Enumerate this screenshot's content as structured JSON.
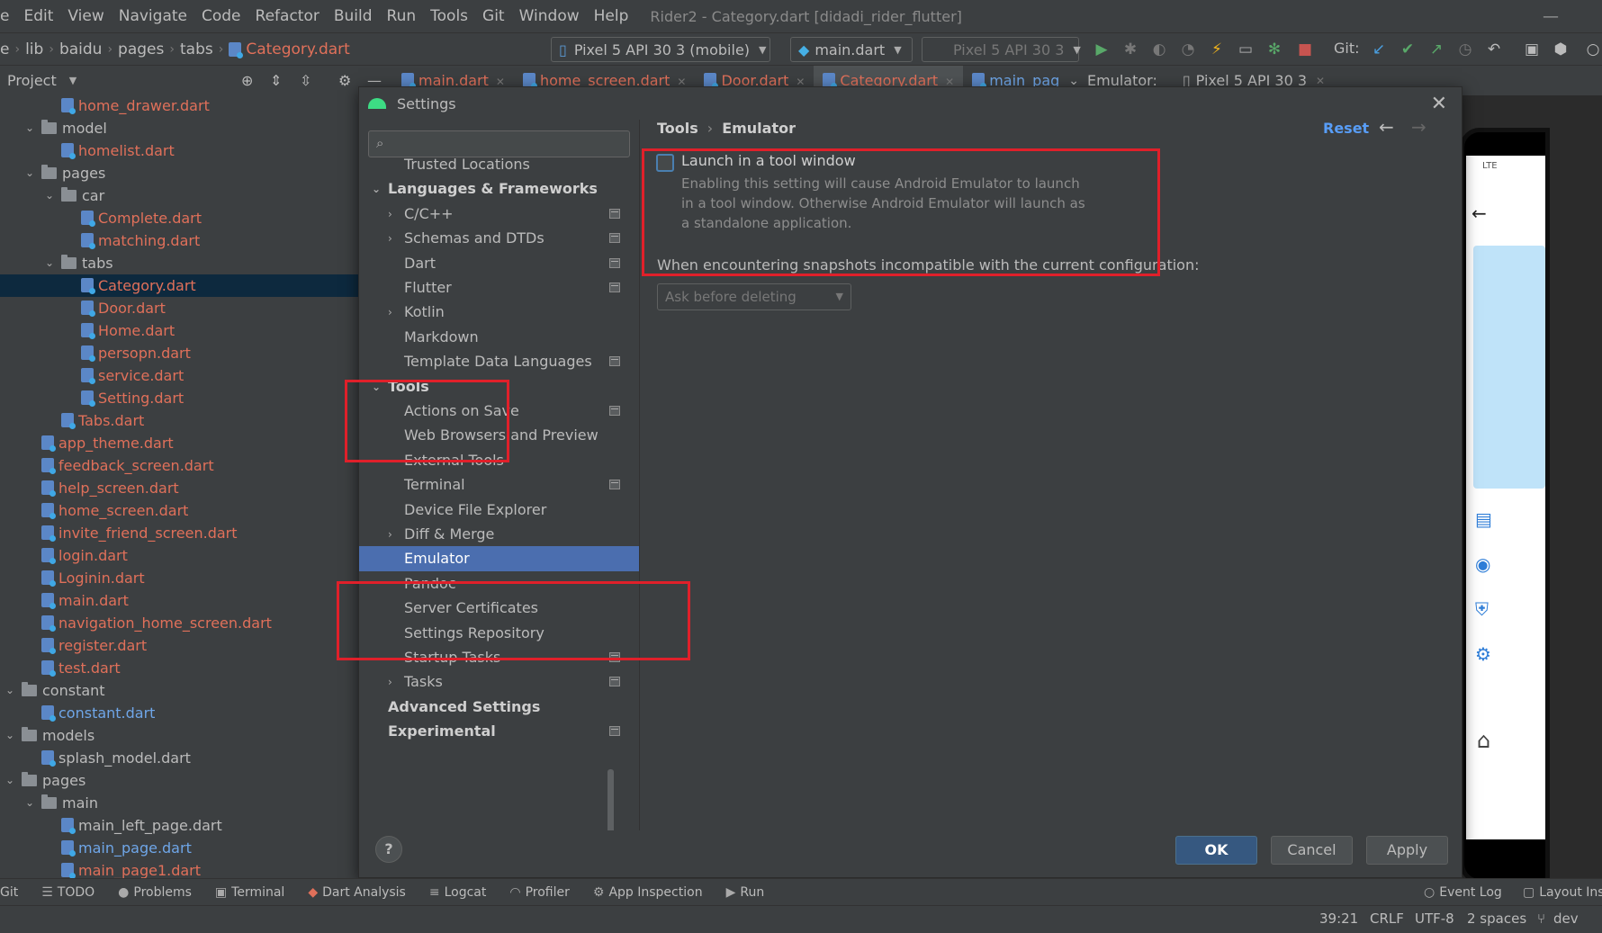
{
  "menubar": {
    "items": [
      "e",
      "Edit",
      "View",
      "Navigate",
      "Code",
      "Refactor",
      "Build",
      "Run",
      "Tools",
      "Git",
      "Window",
      "Help"
    ],
    "title": "Rider2 - Category.dart [didadi_rider_flutter]"
  },
  "navbar": {
    "crumbs": [
      "e",
      "lib",
      "baidu",
      "pages",
      "tabs",
      "Category.dart"
    ],
    "device_combo": "Pixel 5 API 30 3 (mobile)",
    "run_combo": "main.dart",
    "emulator_combo": "Pixel 5 API 30 3",
    "git_label": "Git:"
  },
  "project": {
    "header": "Project",
    "rows": [
      {
        "label": "home_drawer.dart",
        "type": "file",
        "color": "red",
        "indent": 2
      },
      {
        "label": "model",
        "type": "folder",
        "color": "gray",
        "indent": 1,
        "expanded": true
      },
      {
        "label": "homelist.dart",
        "type": "file",
        "color": "red",
        "indent": 2
      },
      {
        "label": "pages",
        "type": "folder",
        "color": "gray",
        "indent": 1,
        "expanded": true
      },
      {
        "label": "car",
        "type": "folder",
        "color": "gray",
        "indent": 2,
        "expanded": true
      },
      {
        "label": "Complete.dart",
        "type": "file",
        "color": "red",
        "indent": 3
      },
      {
        "label": "matching.dart",
        "type": "file",
        "color": "red",
        "indent": 3
      },
      {
        "label": "tabs",
        "type": "folder",
        "color": "gray",
        "indent": 2,
        "expanded": true
      },
      {
        "label": "Category.dart",
        "type": "file",
        "color": "red",
        "indent": 3,
        "selected": true
      },
      {
        "label": "Door.dart",
        "type": "file",
        "color": "red",
        "indent": 3
      },
      {
        "label": "Home.dart",
        "type": "file",
        "color": "red",
        "indent": 3
      },
      {
        "label": "persopn.dart",
        "type": "file",
        "color": "red",
        "indent": 3
      },
      {
        "label": "service.dart",
        "type": "file",
        "color": "red",
        "indent": 3
      },
      {
        "label": "Setting.dart",
        "type": "file",
        "color": "red",
        "indent": 3
      },
      {
        "label": "Tabs.dart",
        "type": "file",
        "color": "red",
        "indent": 2
      },
      {
        "label": "app_theme.dart",
        "type": "file",
        "color": "red",
        "indent": 1
      },
      {
        "label": "feedback_screen.dart",
        "type": "file",
        "color": "red",
        "indent": 1
      },
      {
        "label": "help_screen.dart",
        "type": "file",
        "color": "red",
        "indent": 1
      },
      {
        "label": "home_screen.dart",
        "type": "file",
        "color": "red",
        "indent": 1
      },
      {
        "label": "invite_friend_screen.dart",
        "type": "file",
        "color": "red",
        "indent": 1
      },
      {
        "label": "login.dart",
        "type": "file",
        "color": "red",
        "indent": 1
      },
      {
        "label": "Loginin.dart",
        "type": "file",
        "color": "red",
        "indent": 1
      },
      {
        "label": "main.dart",
        "type": "file",
        "color": "red",
        "indent": 1
      },
      {
        "label": "navigation_home_screen.dart",
        "type": "file",
        "color": "red",
        "indent": 1
      },
      {
        "label": "register.dart",
        "type": "file",
        "color": "red",
        "indent": 1
      },
      {
        "label": "test.dart",
        "type": "file",
        "color": "red",
        "indent": 1
      },
      {
        "label": "constant",
        "type": "folder",
        "color": "gray",
        "indent": 0,
        "expanded": true
      },
      {
        "label": "constant.dart",
        "type": "file",
        "color": "blue",
        "indent": 1
      },
      {
        "label": "models",
        "type": "folder",
        "color": "gray",
        "indent": 0,
        "expanded": true
      },
      {
        "label": "splash_model.dart",
        "type": "file",
        "color": "gray",
        "indent": 1
      },
      {
        "label": "pages",
        "type": "folder",
        "color": "gray",
        "indent": 0,
        "expanded": true
      },
      {
        "label": "main",
        "type": "folder",
        "color": "gray",
        "indent": 1,
        "expanded": true
      },
      {
        "label": "main_left_page.dart",
        "type": "file",
        "color": "gray",
        "indent": 2
      },
      {
        "label": "main_page.dart",
        "type": "file",
        "color": "blue",
        "indent": 2
      },
      {
        "label": "main_page1.dart",
        "type": "file",
        "color": "red",
        "indent": 2
      }
    ]
  },
  "editor_tabs": [
    {
      "label": "main.dart",
      "active": false
    },
    {
      "label": "home_screen.dart",
      "active": false
    },
    {
      "label": "Door.dart",
      "active": false
    },
    {
      "label": "Category.dart",
      "active": true
    },
    {
      "label": "main_pag",
      "active": false
    }
  ],
  "emulator_bar": {
    "label": "Emulator:",
    "device": "Pixel 5 API 30 3"
  },
  "dialog": {
    "title": "Settings",
    "search_placeholder": "",
    "tree": [
      {
        "label": "Trusted Locations",
        "level": 2,
        "bold": false,
        "arrow": "",
        "proj": false
      },
      {
        "label": "Languages & Frameworks",
        "level": 1,
        "bold": true,
        "arrow": "down",
        "proj": false
      },
      {
        "label": "C/C++",
        "level": 2,
        "bold": false,
        "arrow": "right",
        "proj": true
      },
      {
        "label": "Schemas and DTDs",
        "level": 2,
        "bold": false,
        "arrow": "right",
        "proj": true
      },
      {
        "label": "Dart",
        "level": 2,
        "bold": false,
        "arrow": "",
        "proj": true
      },
      {
        "label": "Flutter",
        "level": 2,
        "bold": false,
        "arrow": "",
        "proj": true
      },
      {
        "label": "Kotlin",
        "level": 2,
        "bold": false,
        "arrow": "right",
        "proj": false
      },
      {
        "label": "Markdown",
        "level": 2,
        "bold": false,
        "arrow": "",
        "proj": false
      },
      {
        "label": "Template Data Languages",
        "level": 2,
        "bold": false,
        "arrow": "",
        "proj": true
      },
      {
        "label": "Tools",
        "level": 1,
        "bold": true,
        "arrow": "down",
        "proj": false
      },
      {
        "label": "Actions on Save",
        "level": 2,
        "bold": false,
        "arrow": "",
        "proj": true
      },
      {
        "label": "Web Browsers and Preview",
        "level": 2,
        "bold": false,
        "arrow": "",
        "proj": false
      },
      {
        "label": "External Tools",
        "level": 2,
        "bold": false,
        "arrow": "",
        "proj": false
      },
      {
        "label": "Terminal",
        "level": 2,
        "bold": false,
        "arrow": "",
        "proj": true
      },
      {
        "label": "Device File Explorer",
        "level": 2,
        "bold": false,
        "arrow": "",
        "proj": false
      },
      {
        "label": "Diff & Merge",
        "level": 2,
        "bold": false,
        "arrow": "right",
        "proj": false
      },
      {
        "label": "Emulator",
        "level": 2,
        "bold": false,
        "arrow": "",
        "proj": false,
        "selected": true
      },
      {
        "label": "Pandoc",
        "level": 2,
        "bold": false,
        "arrow": "",
        "proj": false
      },
      {
        "label": "Server Certificates",
        "level": 2,
        "bold": false,
        "arrow": "",
        "proj": false
      },
      {
        "label": "Settings Repository",
        "level": 2,
        "bold": false,
        "arrow": "",
        "proj": false
      },
      {
        "label": "Startup Tasks",
        "level": 2,
        "bold": false,
        "arrow": "",
        "proj": true
      },
      {
        "label": "Tasks",
        "level": 2,
        "bold": false,
        "arrow": "right",
        "proj": true
      },
      {
        "label": "Advanced Settings",
        "level": 1,
        "bold": true,
        "arrow": "",
        "proj": false
      },
      {
        "label": "Experimental",
        "level": 1,
        "bold": true,
        "arrow": "",
        "proj": true
      }
    ],
    "breadcrumb": {
      "parent": "Tools",
      "current": "Emulator"
    },
    "reset": "Reset",
    "launch": {
      "label": "Launch in a tool window",
      "checked": false,
      "help": "Enabling this setting will cause Android Emulator to launch in a tool window. Otherwise Android Emulator will launch as a standalone application."
    },
    "snapshots": {
      "label": "When encountering snapshots incompatible with the current configuration:",
      "value": "Ask before deleting"
    },
    "buttons": {
      "ok": "OK",
      "cancel": "Cancel",
      "apply": "Apply",
      "help": "?"
    }
  },
  "toolwindows": [
    "Git",
    "TODO",
    "Problems",
    "Terminal",
    "Dart Analysis",
    "Logcat",
    "Profiler",
    "App Inspection",
    "Run"
  ],
  "toolwindows_right": [
    "Event Log",
    "Layout Insp"
  ],
  "statusbar": {
    "position": "39:21",
    "line_sep": "CRLF",
    "encoding": "UTF-8",
    "indent": "2 spaces",
    "branch": "dev"
  },
  "phone": {
    "status": "LTE"
  },
  "colors": {
    "accent": "#4b6eaf",
    "annotation_red": "#e0202a",
    "modified_file": "#e0705a",
    "new_file": "#6fa6e8",
    "link": "#589df6"
  }
}
